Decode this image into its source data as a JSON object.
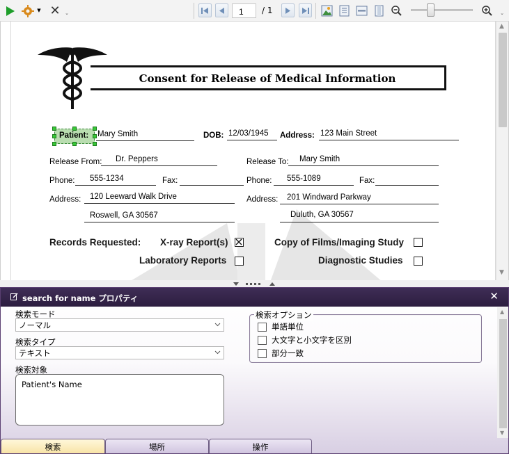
{
  "toolbar": {
    "page_current": "1",
    "page_total": "/ 1",
    "icons": [
      "play-icon",
      "gear-icon",
      "close-icon",
      "first-page-icon",
      "prev-page-icon",
      "next-page-icon",
      "last-page-icon",
      "image-icon",
      "fit-page-icon",
      "fit-width-icon",
      "single-page-icon",
      "zoom-out-icon",
      "zoom-in-icon"
    ]
  },
  "document": {
    "title": "Consent for Release of Medical Information",
    "patient_label": "Patient:",
    "patient_value": "Mary Smith",
    "dob_label": "DOB:",
    "dob_value": "12/03/1945",
    "address_label": "Address:",
    "address_value": "123 Main Street",
    "release_from_label": "Release From:",
    "release_from_value": "Dr. Peppers",
    "release_to_label": "Release To:",
    "release_to_value": "Mary Smith",
    "phone_label": "Phone:",
    "phone_from_value": "555-1234",
    "fax_label": "Fax:",
    "phone_to_value": "555-1089",
    "address_plain_label": "Address:",
    "from_addr1": "120 Leeward Walk Drive",
    "from_addr2": "Roswell, GA 30567",
    "to_addr1": "201 Windward Parkway",
    "to_addr2": "Duluth, GA 30567",
    "records_requested_label": "Records Requested:",
    "xray_label": "X-ray Report(s)",
    "xray_checked": "true",
    "films_label": "Copy of Films/Imaging Study",
    "lab_label": "Laboratory Reports",
    "diag_label": "Diagnostic Studies"
  },
  "panel": {
    "title": "search for name プロパティ",
    "search_mode_label": "検索モード",
    "search_mode_value": "ノーマル",
    "search_type_label": "検索タイプ",
    "search_type_value": "テキスト",
    "search_target_label": "検索対象",
    "search_target_value": "Patient's Name",
    "options_label": "検索オプション",
    "option_whole_word": "単語単位",
    "option_match_case": "大文字と小文字を区別",
    "option_partial": "部分一致",
    "tabs": [
      "検索",
      "場所",
      "操作"
    ]
  }
}
